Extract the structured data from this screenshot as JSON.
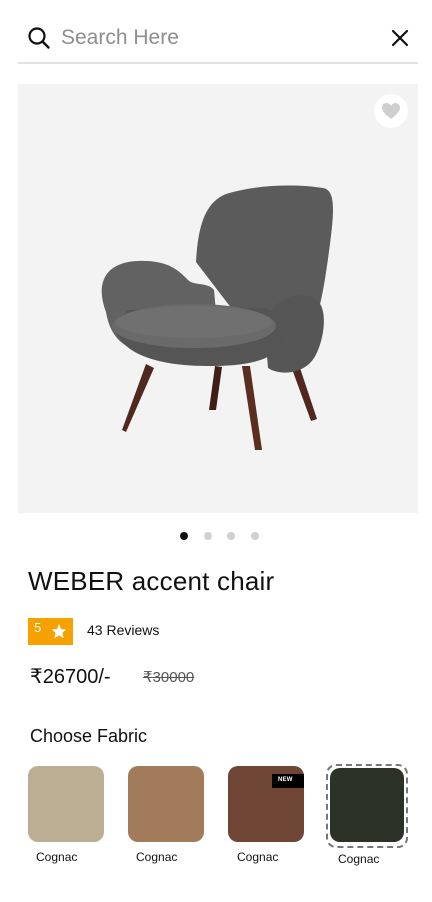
{
  "search": {
    "placeholder": "Search Here"
  },
  "product": {
    "title": "WEBER accent chair",
    "rating": "5",
    "reviews": "43 Reviews",
    "price": "₹26700/-",
    "old_price": "₹30000",
    "image_count": 4,
    "active_image": 0
  },
  "fabric": {
    "heading": "Choose Fabric",
    "options": [
      {
        "label": "Cognac",
        "color": "#bcae93",
        "badge": ""
      },
      {
        "label": "Cognac",
        "color": "#a27b5b",
        "badge": ""
      },
      {
        "label": "Cognac",
        "color": "#6f4636",
        "badge": "NEW"
      },
      {
        "label": "Cognac",
        "color": "#2d3228",
        "badge": "",
        "selected": true
      }
    ]
  },
  "colors": {
    "accent": "#f5a100",
    "image_bg": "#f3f3f3",
    "chair_fabric": "#585858",
    "chair_legs": "#5a2f22"
  }
}
